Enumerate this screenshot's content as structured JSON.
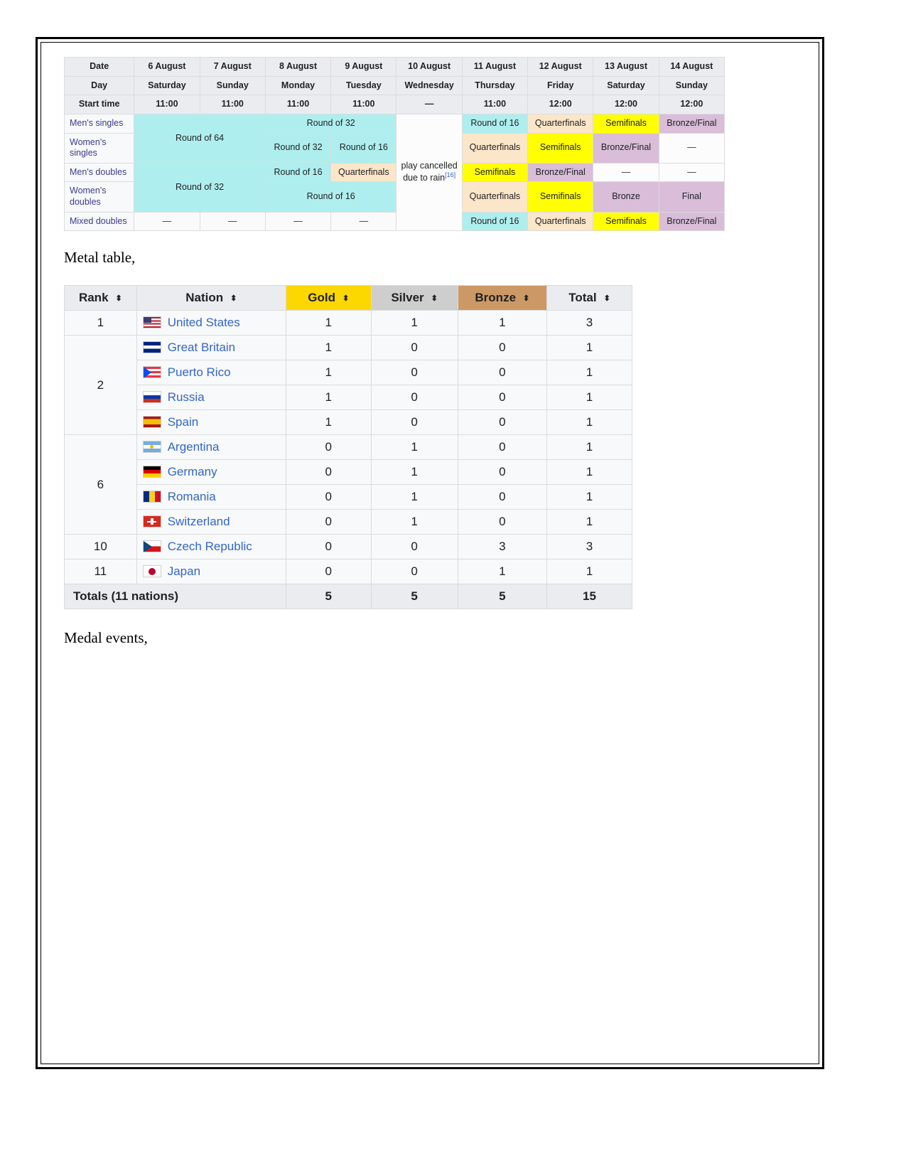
{
  "document": {
    "captions": {
      "medal_table": "Metal table,",
      "medal_events": "Medal events,"
    }
  },
  "schedule": {
    "row_labels": {
      "date": "Date",
      "day": "Day",
      "start_time": "Start time"
    },
    "dates": [
      "6 August",
      "7 August",
      "8 August",
      "9 August",
      "10 August",
      "11 August",
      "12 August",
      "13 August",
      "14 August"
    ],
    "days": [
      "Saturday",
      "Sunday",
      "Monday",
      "Tuesday",
      "Wednesday",
      "Thursday",
      "Friday",
      "Saturday",
      "Sunday"
    ],
    "start_times": [
      "11:00",
      "11:00",
      "11:00",
      "11:00",
      "—",
      "11:00",
      "12:00",
      "12:00",
      "12:00"
    ],
    "rain_note": {
      "text": "play cancelled due to rain",
      "ref": "[16]"
    },
    "events": [
      {
        "name": "Men's singles",
        "cells": [
          {
            "label": "Round of 64",
            "span": 2,
            "color": "teal"
          },
          {
            "label": "Round of 32",
            "span": 2,
            "color": "teal"
          },
          {
            "label": "Round of 16",
            "span": 1,
            "color": "teal"
          },
          {
            "label": "Quarterfinals",
            "span": 1,
            "color": "orange"
          },
          {
            "label": "Semifinals",
            "span": 1,
            "color": "yellow"
          },
          {
            "label": "Bronze/Final",
            "span": 1,
            "color": "purple"
          }
        ]
      },
      {
        "name": "Women's singles",
        "cells": [
          {
            "label": "Round of 32",
            "span": 1,
            "color": "teal"
          },
          {
            "label": "Round of 16",
            "span": 1,
            "color": "teal"
          },
          {
            "label": "Quarterfinals",
            "span": 1,
            "color": "orange"
          },
          {
            "label": "Semifinals",
            "span": 1,
            "color": "yellow"
          },
          {
            "label": "Bronze/Final",
            "span": 1,
            "color": "purple"
          },
          {
            "label": "—",
            "span": 1,
            "color": "none"
          }
        ]
      },
      {
        "name": "Men's doubles",
        "cells": [
          {
            "label": "Round of 32",
            "span": 2,
            "color": "teal"
          },
          {
            "label": "Round of 16",
            "span": 1,
            "color": "teal"
          },
          {
            "label": "Quarterfinals",
            "span": 1,
            "color": "orange"
          },
          {
            "label": "Semifinals",
            "span": 1,
            "color": "yellow"
          },
          {
            "label": "Bronze/Final",
            "span": 1,
            "color": "purple"
          },
          {
            "label": "—",
            "span": 1,
            "color": "none"
          },
          {
            "label": "—",
            "span": 1,
            "color": "none"
          }
        ]
      },
      {
        "name": "Women's doubles",
        "cells": [
          {
            "label": "Round of 16",
            "span": 2,
            "color": "teal"
          },
          {
            "label": "Quarterfinals",
            "span": 1,
            "color": "orange"
          },
          {
            "label": "Semifinals",
            "span": 1,
            "color": "yellow"
          },
          {
            "label": "Bronze",
            "span": 1,
            "color": "purple"
          },
          {
            "label": "Final",
            "span": 1,
            "color": "purple"
          }
        ]
      },
      {
        "name": "Mixed doubles",
        "cells": [
          {
            "label": "—",
            "span": 1,
            "color": "blank"
          },
          {
            "label": "—",
            "span": 1,
            "color": "blank"
          },
          {
            "label": "—",
            "span": 1,
            "color": "blank"
          },
          {
            "label": "—",
            "span": 1,
            "color": "blank"
          },
          {
            "label": "Round of 16",
            "span": 1,
            "color": "teal"
          },
          {
            "label": "Quarterfinals",
            "span": 1,
            "color": "orange"
          },
          {
            "label": "Semifinals",
            "span": 1,
            "color": "yellow"
          },
          {
            "label": "Bronze/Final",
            "span": 1,
            "color": "purple"
          }
        ]
      }
    ],
    "colors": {
      "teal": "#afeeee",
      "orange": "#fce6c9",
      "yellow": "#ffff00",
      "purple": "#d9bdd9",
      "header": "#eaecf0"
    }
  },
  "medal_table": {
    "columns": [
      "Rank",
      "Nation",
      "Gold",
      "Silver",
      "Bronze",
      "Total"
    ],
    "sort_icon": "⬍",
    "header_colors": {
      "gold": "#fcd700",
      "silver": "#cecece",
      "bronze": "#cc9966"
    },
    "rows": [
      {
        "rank": "1",
        "rank_span": 1,
        "nation": "United States",
        "flag": "flag-us",
        "gold": "1",
        "silver": "1",
        "bronze": "1",
        "total": "3"
      },
      {
        "rank": "2",
        "rank_span": 4,
        "nation": "Great Britain",
        "flag": "flag-gb",
        "gold": "1",
        "silver": "0",
        "bronze": "0",
        "total": "1"
      },
      {
        "rank": "",
        "rank_span": 0,
        "nation": "Puerto Rico",
        "flag": "flag-pr",
        "gold": "1",
        "silver": "0",
        "bronze": "0",
        "total": "1"
      },
      {
        "rank": "",
        "rank_span": 0,
        "nation": "Russia",
        "flag": "flag-ru",
        "gold": "1",
        "silver": "0",
        "bronze": "0",
        "total": "1"
      },
      {
        "rank": "",
        "rank_span": 0,
        "nation": "Spain",
        "flag": "flag-es",
        "gold": "1",
        "silver": "0",
        "bronze": "0",
        "total": "1"
      },
      {
        "rank": "6",
        "rank_span": 4,
        "nation": "Argentina",
        "flag": "flag-ar",
        "gold": "0",
        "silver": "1",
        "bronze": "0",
        "total": "1"
      },
      {
        "rank": "",
        "rank_span": 0,
        "nation": "Germany",
        "flag": "flag-de",
        "gold": "0",
        "silver": "1",
        "bronze": "0",
        "total": "1"
      },
      {
        "rank": "",
        "rank_span": 0,
        "nation": "Romania",
        "flag": "flag-ro",
        "gold": "0",
        "silver": "1",
        "bronze": "0",
        "total": "1"
      },
      {
        "rank": "",
        "rank_span": 0,
        "nation": "Switzerland",
        "flag": "flag-ch",
        "gold": "0",
        "silver": "1",
        "bronze": "0",
        "total": "1"
      },
      {
        "rank": "10",
        "rank_span": 1,
        "nation": "Czech Republic",
        "flag": "flag-cz",
        "gold": "0",
        "silver": "0",
        "bronze": "3",
        "total": "3"
      },
      {
        "rank": "11",
        "rank_span": 1,
        "nation": "Japan",
        "flag": "flag-jp",
        "gold": "0",
        "silver": "0",
        "bronze": "1",
        "total": "1"
      }
    ],
    "totals": {
      "label": "Totals (11 nations)",
      "gold": "5",
      "silver": "5",
      "bronze": "5",
      "total": "15"
    }
  }
}
